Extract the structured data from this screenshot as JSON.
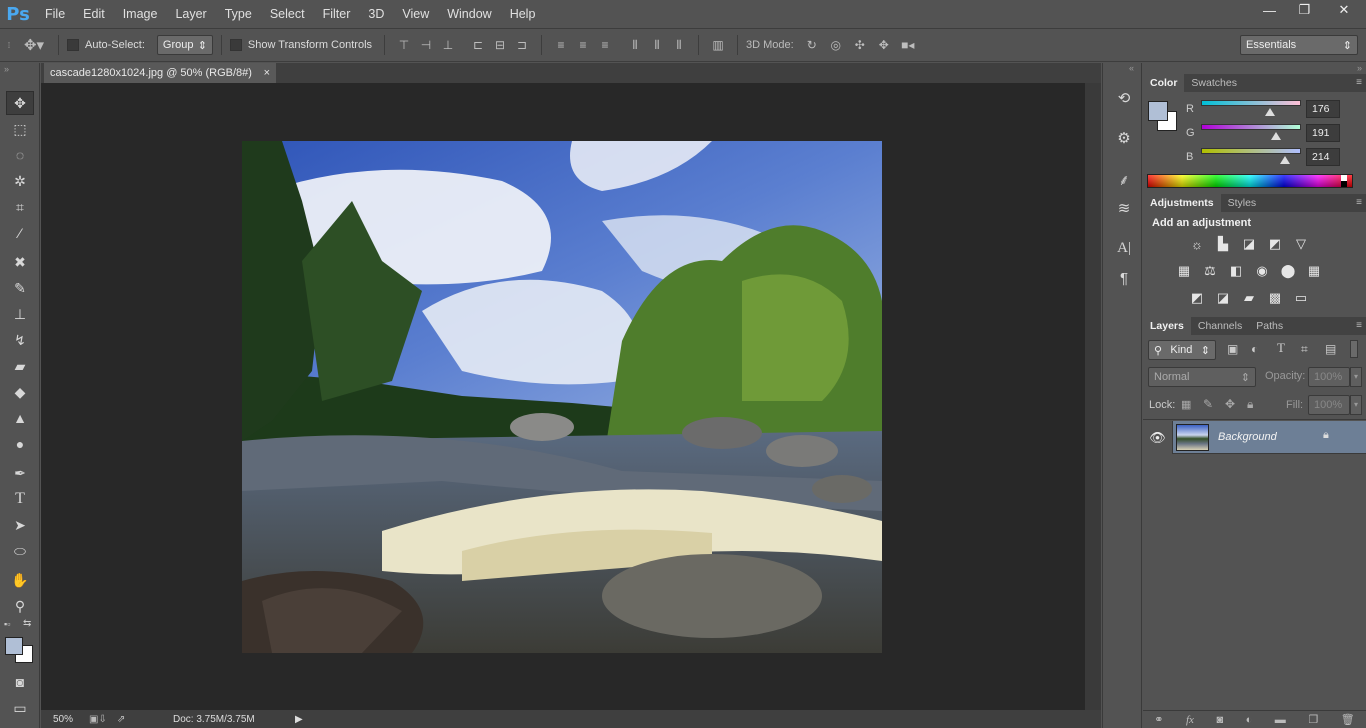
{
  "app": {
    "logo": "Ps"
  },
  "menu": [
    "File",
    "Edit",
    "Image",
    "Layer",
    "Type",
    "Select",
    "Filter",
    "3D",
    "View",
    "Window",
    "Help"
  ],
  "window_controls": {
    "minimize": "—",
    "restore": "❐",
    "close": "✕"
  },
  "options": {
    "auto_select_label": "Auto-Select:",
    "auto_select_value": "Group",
    "transform_label": "Show Transform Controls",
    "mode3d_label": "3D Mode:",
    "workspace": "Essentials"
  },
  "document": {
    "tab_title": "cascade1280x1024.jpg @ 50% (RGB/8#)",
    "tab_close": "×",
    "zoom": "50%",
    "doc_size": "Doc: 3.75M/3.75M"
  },
  "color_panel": {
    "tabs": [
      "Color",
      "Swatches"
    ],
    "r_label": "R",
    "g_label": "G",
    "b_label": "B",
    "r": "176",
    "g": "191",
    "b": "214",
    "r_fraction": 0.69,
    "g_fraction": 0.75,
    "b_fraction": 0.84,
    "fg_color": "#b0bfd6",
    "bg_color": "#ffffff"
  },
  "adjustments_panel": {
    "tabs": [
      "Adjustments",
      "Styles"
    ],
    "heading": "Add an adjustment"
  },
  "layers_panel": {
    "tabs": [
      "Layers",
      "Channels",
      "Paths"
    ],
    "filter_label": "Kind",
    "blend_mode": "Normal",
    "opacity_label": "Opacity:",
    "opacity": "100%",
    "lock_label": "Lock:",
    "fill_label": "Fill:",
    "fill": "100%",
    "layers": [
      {
        "name": "Background"
      }
    ]
  },
  "colors": {
    "accent": "#4aa8f0",
    "selected_layer": "#6d7f96"
  }
}
